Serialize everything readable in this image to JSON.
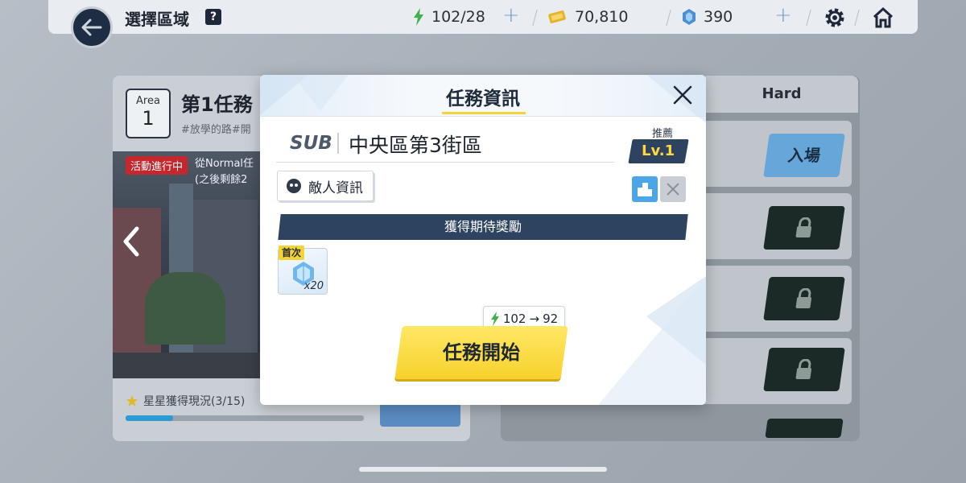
{
  "topbar": {
    "title": "選擇區域",
    "help": "?",
    "stamina": "102/28",
    "credits": "70,810",
    "gems": "390"
  },
  "left_panel": {
    "area_label": "Area",
    "area_number": "1",
    "mission_title": "第1任務",
    "mission_tags": "#放學的路#開",
    "event_badge": "活動進行中",
    "event_text_line1": "從Normal任",
    "event_text_line2": "(之後剩餘2",
    "stars_progress_label": "星星獲得現況(3/15)",
    "stars_progress_fraction": 0.2
  },
  "right_panel": {
    "hard_tab": "Hard",
    "enter_label": "入場"
  },
  "modal": {
    "title": "任務資訊",
    "sub_label": "SUB",
    "stage_name": "中央區第3街區",
    "recommended_label": "推薦",
    "recommended_level": "Lv.1",
    "enemy_info_button": "敵人資訊",
    "reward_header": "獲得期待獎勵",
    "reward_first_tag": "首次",
    "reward_quantity": "x20",
    "stamina_from": "102",
    "stamina_arrow": "→",
    "stamina_to": "92",
    "start_button": "任務開始"
  },
  "colors": {
    "accent_yellow": "#f7d12c",
    "navy": "#2e4360",
    "blue": "#4aa6e8",
    "lock_bg": "#1b2a26"
  }
}
